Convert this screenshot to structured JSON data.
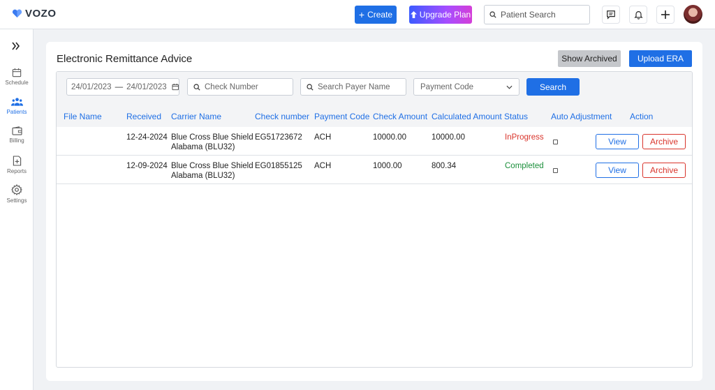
{
  "brand": {
    "name": "VOZO",
    "color": "#1f6fe5"
  },
  "topbar": {
    "create_label": "Create",
    "upgrade_label": "Upgrade Plan",
    "search_placeholder": "Patient Search"
  },
  "sidebar": {
    "items": [
      {
        "label": "Schedule",
        "icon": "calendar-icon"
      },
      {
        "label": "Patients",
        "icon": "patients-icon",
        "active": true
      },
      {
        "label": "Billing",
        "icon": "wallet-icon"
      },
      {
        "label": "Reports",
        "icon": "report-icon"
      },
      {
        "label": "Settings",
        "icon": "gear-icon"
      }
    ]
  },
  "page": {
    "title": "Electronic Remittance Advice",
    "show_archived_label": "Show Archived",
    "upload_label": "Upload ERA"
  },
  "filters": {
    "date_from": "24/01/2023",
    "date_to": "24/01/2023",
    "check_number_placeholder": "Check Number",
    "payer_placeholder": "Search Payer Name",
    "payment_code_placeholder": "Payment Code",
    "search_label": "Search"
  },
  "table": {
    "headers": [
      "File Name",
      "Received",
      "Carrier Name",
      "Check number",
      "Payment Code",
      "Check Amount",
      "Calculated Amount",
      "Status",
      "Auto Adjustment",
      "Action"
    ],
    "rows": [
      {
        "file_name": "",
        "received": "12-24-2024",
        "carrier_line1": "Blue Cross Blue Shield",
        "carrier_line2": "Alabama (BLU32)",
        "check_number": "EG51723672",
        "payment_code": "ACH",
        "check_amount": "10000.00",
        "calculated_amount": "10000.00",
        "status": "InProgress"
      },
      {
        "file_name": "",
        "received": "12-09-2024",
        "carrier_line1": "Blue Cross Blue Shield",
        "carrier_line2": "Alabama (BLU32)",
        "check_number": "EG01855125",
        "payment_code": "ACH",
        "check_amount": "1000.00",
        "calculated_amount": "800.34",
        "status": "Completed"
      }
    ],
    "view_label": "View",
    "archive_label": "Archive"
  }
}
